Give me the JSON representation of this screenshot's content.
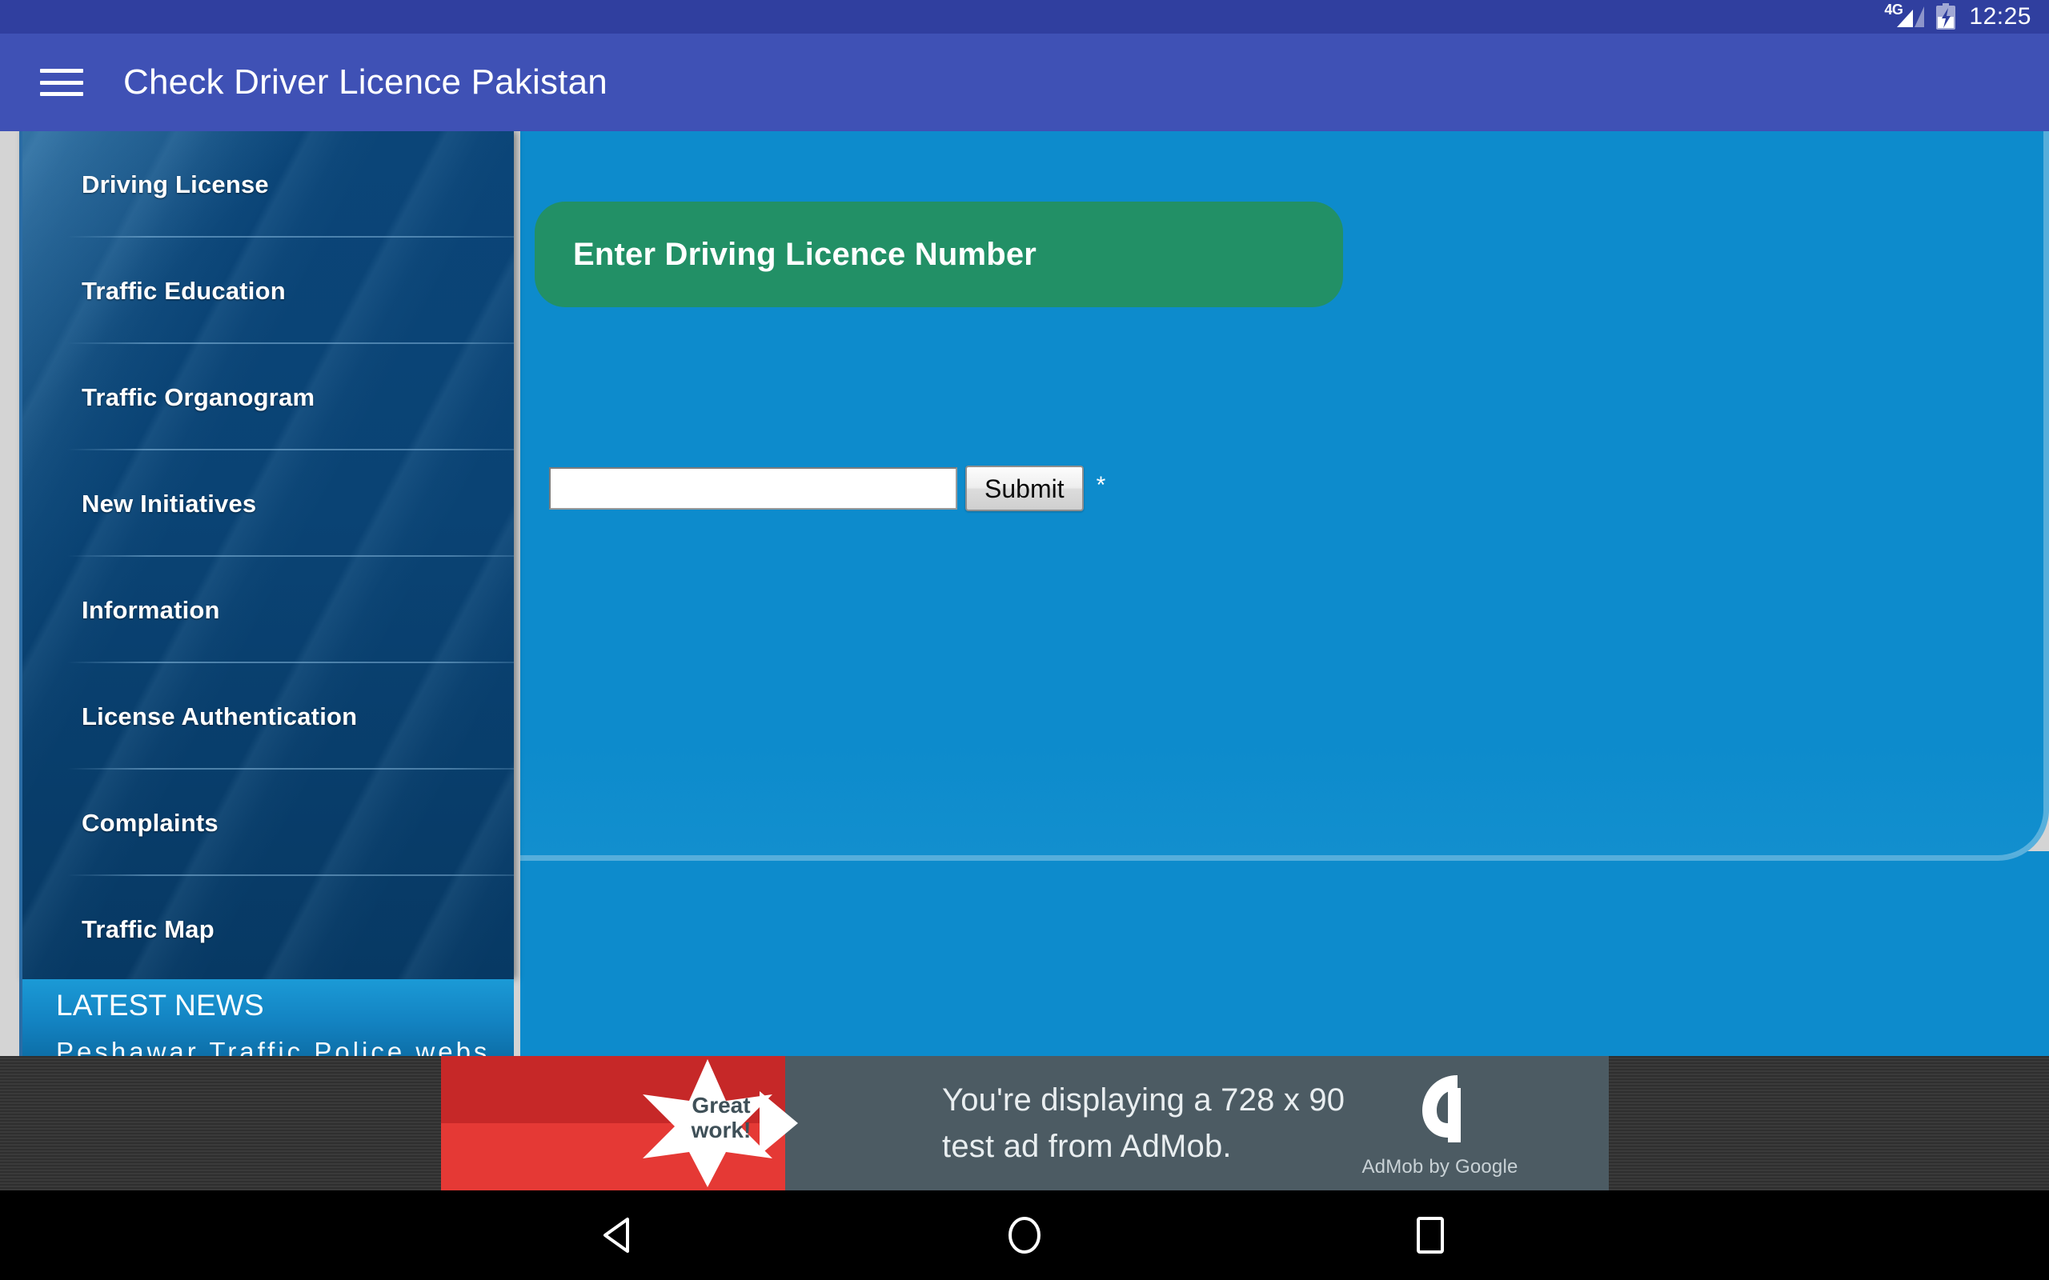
{
  "status_bar": {
    "network_label": "4G",
    "signal_icon": "signal-bars-icon",
    "battery_icon": "battery-charging-icon",
    "time": "12:25"
  },
  "app_bar": {
    "menu_icon": "hamburger-menu-icon",
    "title": "Check Driver Licence Pakistan"
  },
  "sidebar": {
    "items": [
      {
        "label": "Driving License"
      },
      {
        "label": "Traffic Education"
      },
      {
        "label": "Traffic Organogram"
      },
      {
        "label": "New Initiatives"
      },
      {
        "label": "Information"
      },
      {
        "label": "License Authentication"
      },
      {
        "label": "Complaints"
      },
      {
        "label": "Traffic Map"
      }
    ],
    "latest_news": {
      "title": "LATEST NEWS",
      "ticker": "Peshawar Traffic Police webs"
    }
  },
  "main": {
    "form_header": "Enter Driving Licence Number",
    "input_value": "",
    "input_placeholder": "",
    "submit_label": "Submit",
    "required_marker": "*"
  },
  "ad": {
    "badge_line1": "Great",
    "badge_line2": "work!",
    "message_line1": "You're displaying a 728 x 90",
    "message_line2": "test ad from AdMob.",
    "brand": "AdMob by Google",
    "logo_icon": "admob-logo-icon"
  },
  "nav_bar": {
    "back_icon": "back-triangle-icon",
    "home_icon": "home-circle-icon",
    "recents_icon": "recents-square-icon"
  },
  "colors": {
    "status_bar": "#303f9f",
    "app_bar": "#3f51b5",
    "sidebar": "#0a4374",
    "content": "#0d8bcc",
    "green_header": "#229066",
    "news_header": "#1383c2",
    "ad_background": "#4c5b63",
    "ad_accent": "#c62828"
  }
}
